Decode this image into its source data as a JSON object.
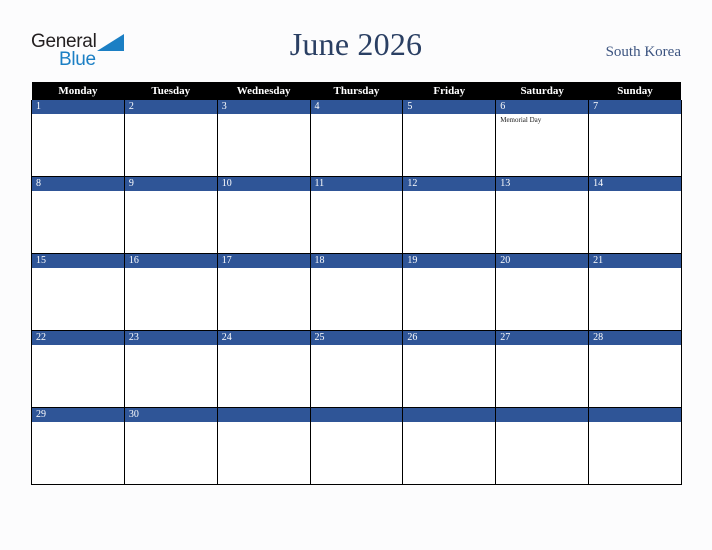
{
  "brand": {
    "name_part1": "General",
    "name_part2": "Blue",
    "triangle_icon": "blue-triangle-logo-mark",
    "color_dark": "#231f20",
    "color_blue": "#1b7fc4"
  },
  "header": {
    "title": "June 2026",
    "country": "South Korea",
    "title_color": "#2a3f63",
    "country_color": "#3c5480"
  },
  "calendar": {
    "accent_color": "#2f5597",
    "header_bg": "#000000",
    "header_text_color": "#ffffff",
    "weekday_headers": [
      "Monday",
      "Tuesday",
      "Wednesday",
      "Thursday",
      "Friday",
      "Saturday",
      "Sunday"
    ],
    "weeks": [
      [
        {
          "day": "1",
          "events": []
        },
        {
          "day": "2",
          "events": []
        },
        {
          "day": "3",
          "events": []
        },
        {
          "day": "4",
          "events": []
        },
        {
          "day": "5",
          "events": []
        },
        {
          "day": "6",
          "events": [
            "Memorial Day"
          ]
        },
        {
          "day": "7",
          "events": []
        }
      ],
      [
        {
          "day": "8",
          "events": []
        },
        {
          "day": "9",
          "events": []
        },
        {
          "day": "10",
          "events": []
        },
        {
          "day": "11",
          "events": []
        },
        {
          "day": "12",
          "events": []
        },
        {
          "day": "13",
          "events": []
        },
        {
          "day": "14",
          "events": []
        }
      ],
      [
        {
          "day": "15",
          "events": []
        },
        {
          "day": "16",
          "events": []
        },
        {
          "day": "17",
          "events": []
        },
        {
          "day": "18",
          "events": []
        },
        {
          "day": "19",
          "events": []
        },
        {
          "day": "20",
          "events": []
        },
        {
          "day": "21",
          "events": []
        }
      ],
      [
        {
          "day": "22",
          "events": []
        },
        {
          "day": "23",
          "events": []
        },
        {
          "day": "24",
          "events": []
        },
        {
          "day": "25",
          "events": []
        },
        {
          "day": "26",
          "events": []
        },
        {
          "day": "27",
          "events": []
        },
        {
          "day": "28",
          "events": []
        }
      ],
      [
        {
          "day": "29",
          "events": []
        },
        {
          "day": "30",
          "events": []
        },
        {
          "day": "",
          "events": []
        },
        {
          "day": "",
          "events": []
        },
        {
          "day": "",
          "events": []
        },
        {
          "day": "",
          "events": []
        },
        {
          "day": "",
          "events": []
        }
      ]
    ]
  }
}
